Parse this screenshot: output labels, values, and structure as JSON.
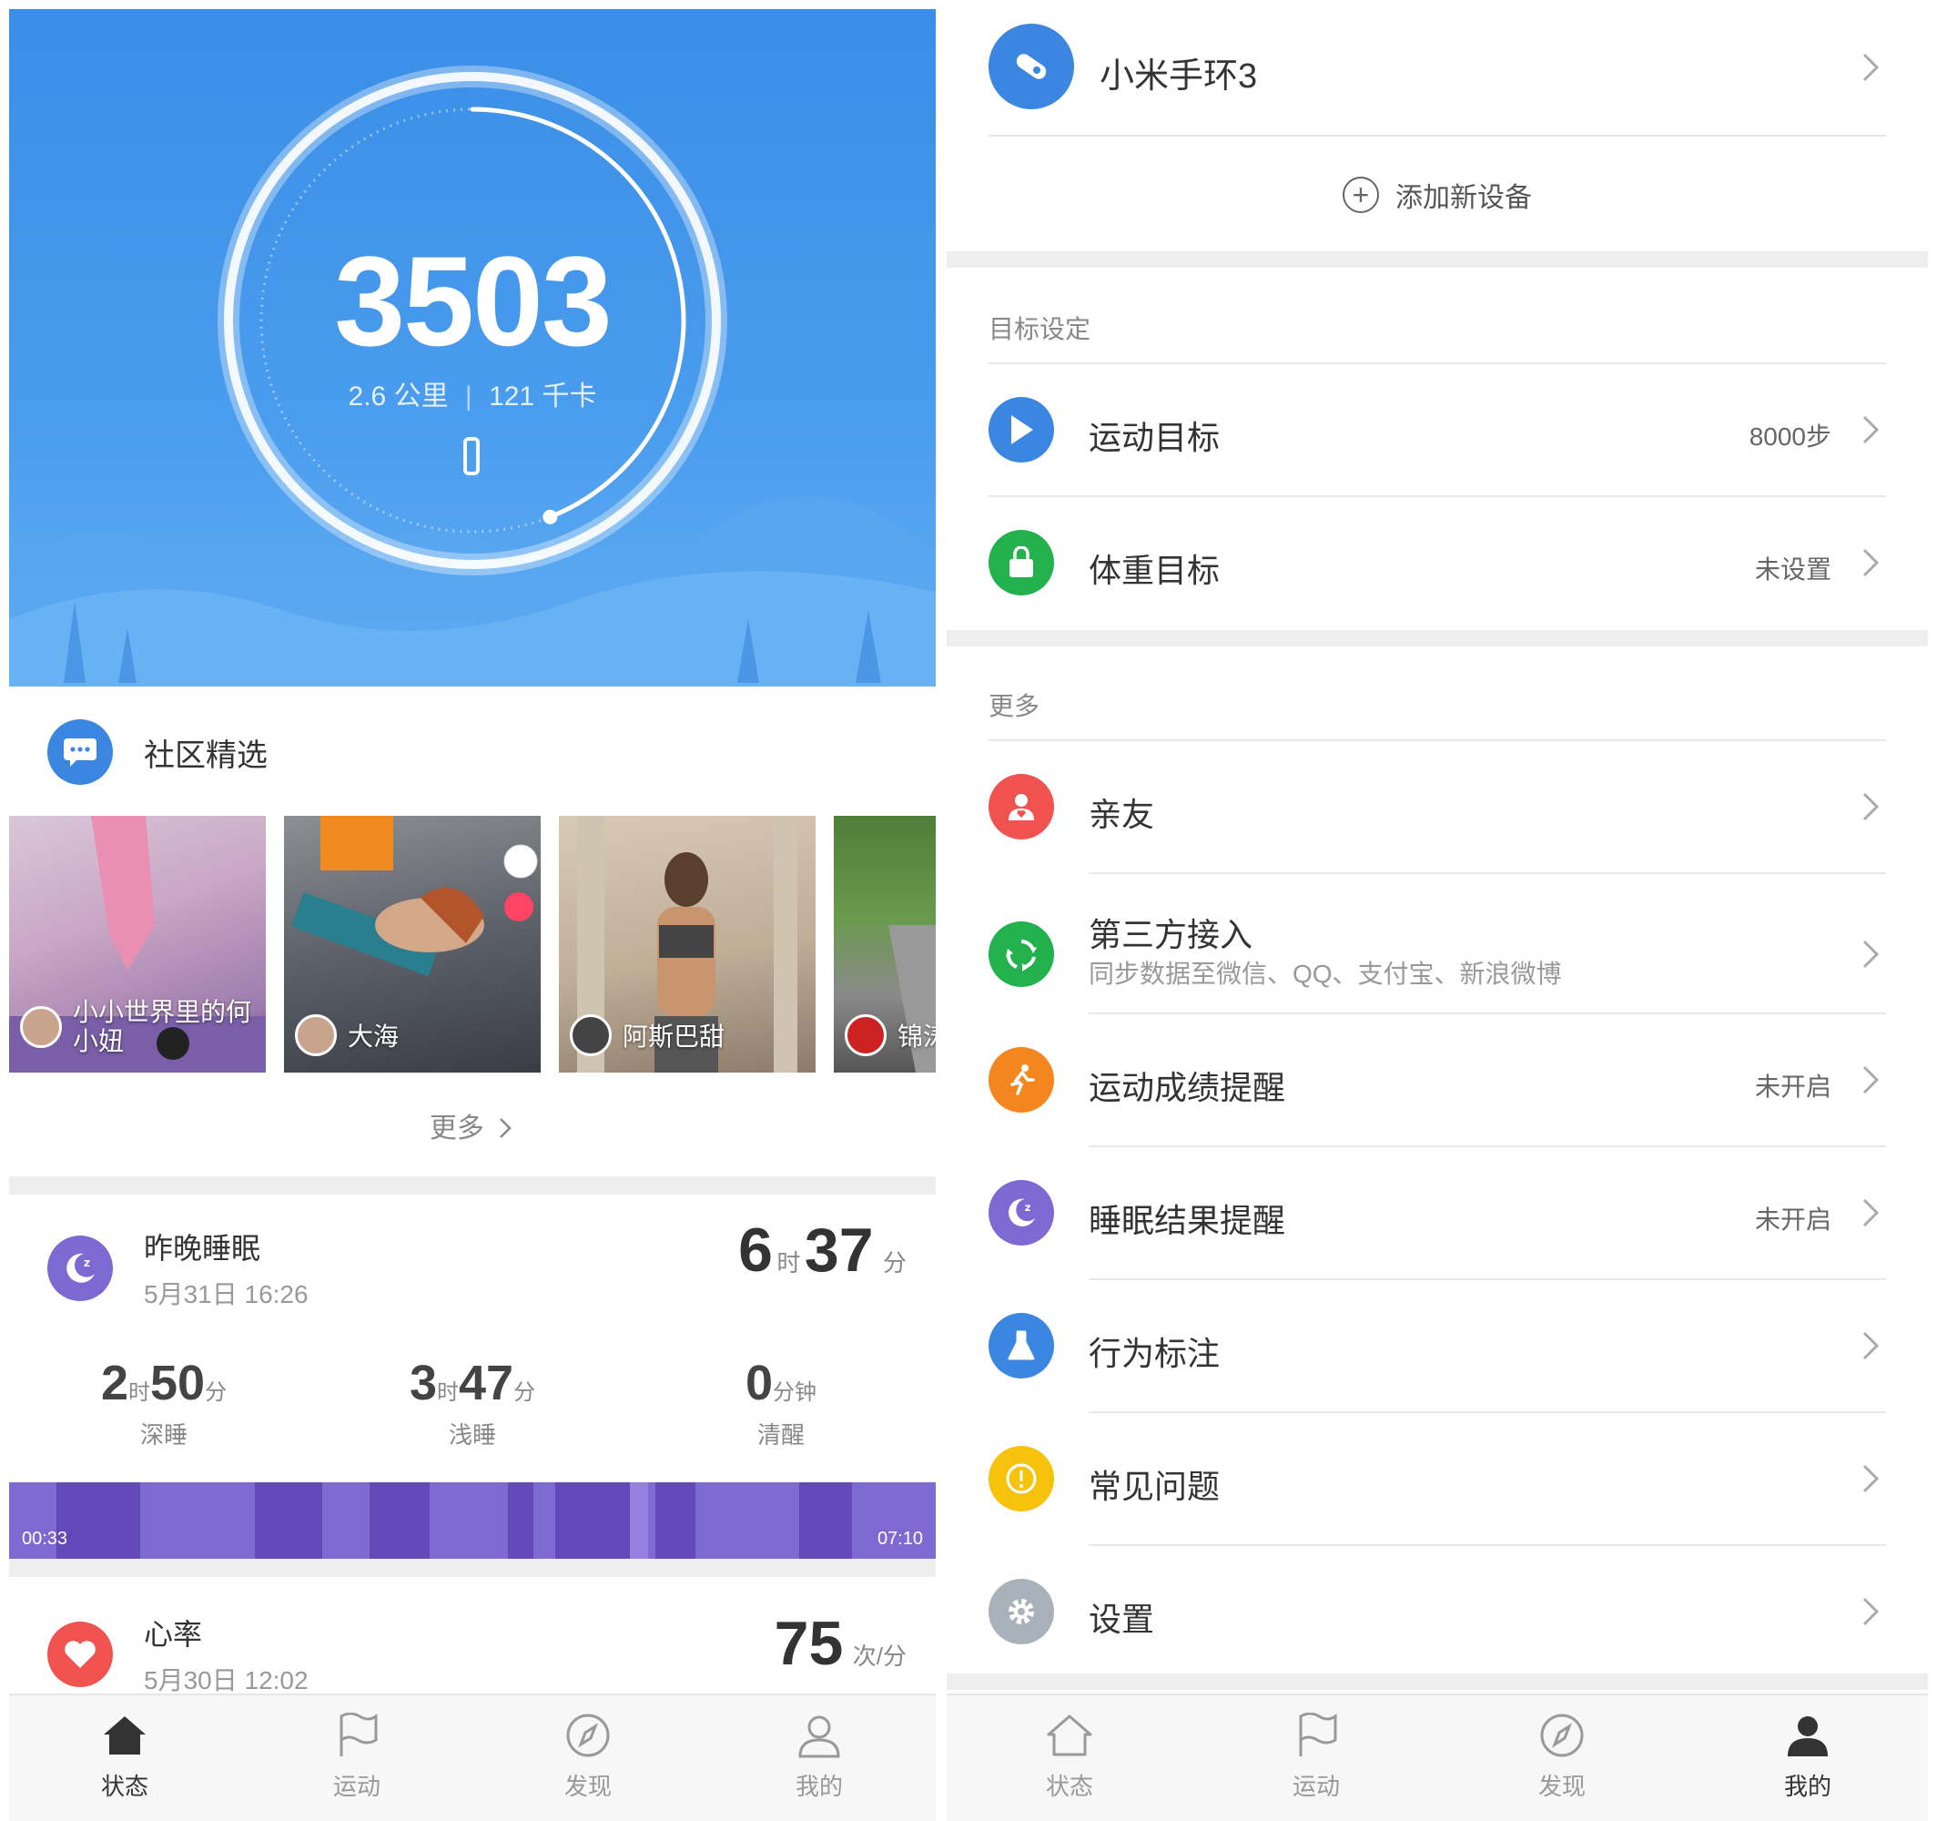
{
  "status_screen": {
    "steps": "3503",
    "distance": "2.6 公里",
    "separator": "|",
    "calories": "121 千卡",
    "step_goal_progress": 0.44,
    "community": {
      "title": "社区精选",
      "posts": [
        {
          "user": "小小世界里的何小妞"
        },
        {
          "user": "大海"
        },
        {
          "user": "阿斯巴甜"
        },
        {
          "user": "锦涛"
        }
      ],
      "more": "更多"
    },
    "sleep": {
      "title": "昨晚睡眠",
      "datetime": "5月31日 16:26",
      "total_h": "6",
      "total_h_unit": "时",
      "total_m": "37",
      "total_m_unit": "分",
      "deep": {
        "h": "2",
        "h_unit": "时",
        "m": "50",
        "m_unit": "分",
        "label": "深睡"
      },
      "light": {
        "h": "3",
        "h_unit": "时",
        "m": "47",
        "m_unit": "分",
        "label": "浅睡"
      },
      "awake": {
        "m": "0",
        "m_unit": "分钟",
        "label": "清醒"
      },
      "start_time": "00:33",
      "end_time": "07:10"
    },
    "heart": {
      "title": "心率",
      "datetime": "5月30日 12:02",
      "value": "75",
      "unit": "次/分"
    }
  },
  "tabs": [
    {
      "label": "状态",
      "icon": "home-icon"
    },
    {
      "label": "运动",
      "icon": "flag-icon"
    },
    {
      "label": "发现",
      "icon": "compass-icon"
    },
    {
      "label": "我的",
      "icon": "person-icon"
    }
  ],
  "profile_screen": {
    "device": {
      "name": "小米手环3",
      "icon": "band-icon"
    },
    "add_device": "添加新设备",
    "goals_section": "目标设定",
    "goals": [
      {
        "label": "运动目标",
        "value": "8000步",
        "icon": "flag-icon",
        "color": "#3b86e0"
      },
      {
        "label": "体重目标",
        "value": "未设置",
        "icon": "lock-icon",
        "color": "#22b14c"
      }
    ],
    "more_section": "更多",
    "more": [
      {
        "label": "亲友",
        "value": "",
        "icon": "friends-icon",
        "color": "#f0524f"
      },
      {
        "label": "第三方接入",
        "sub": "同步数据至微信、QQ、支付宝、新浪微博",
        "value": "",
        "icon": "recycle-icon",
        "color": "#22b14c"
      },
      {
        "label": "运动成绩提醒",
        "value": "未开启",
        "icon": "runner-icon",
        "color": "#f5861f"
      },
      {
        "label": "睡眠结果提醒",
        "value": "未开启",
        "icon": "moon-icon",
        "color": "#7d69d2"
      },
      {
        "label": "行为标注",
        "value": "",
        "icon": "flask-icon",
        "color": "#3b86e0"
      },
      {
        "label": "常见问题",
        "value": "",
        "icon": "exclamation-icon",
        "color": "#f6c20b"
      },
      {
        "label": "设置",
        "value": "",
        "icon": "gear-icon",
        "color": "#a9b2bb"
      }
    ]
  },
  "colors": {
    "hero_blue": "#3a8ee6",
    "sleep_purple": "#7d69d2",
    "heart_red": "#f0524f",
    "active_tab": "#333333",
    "inactive_tab": "#999999"
  }
}
